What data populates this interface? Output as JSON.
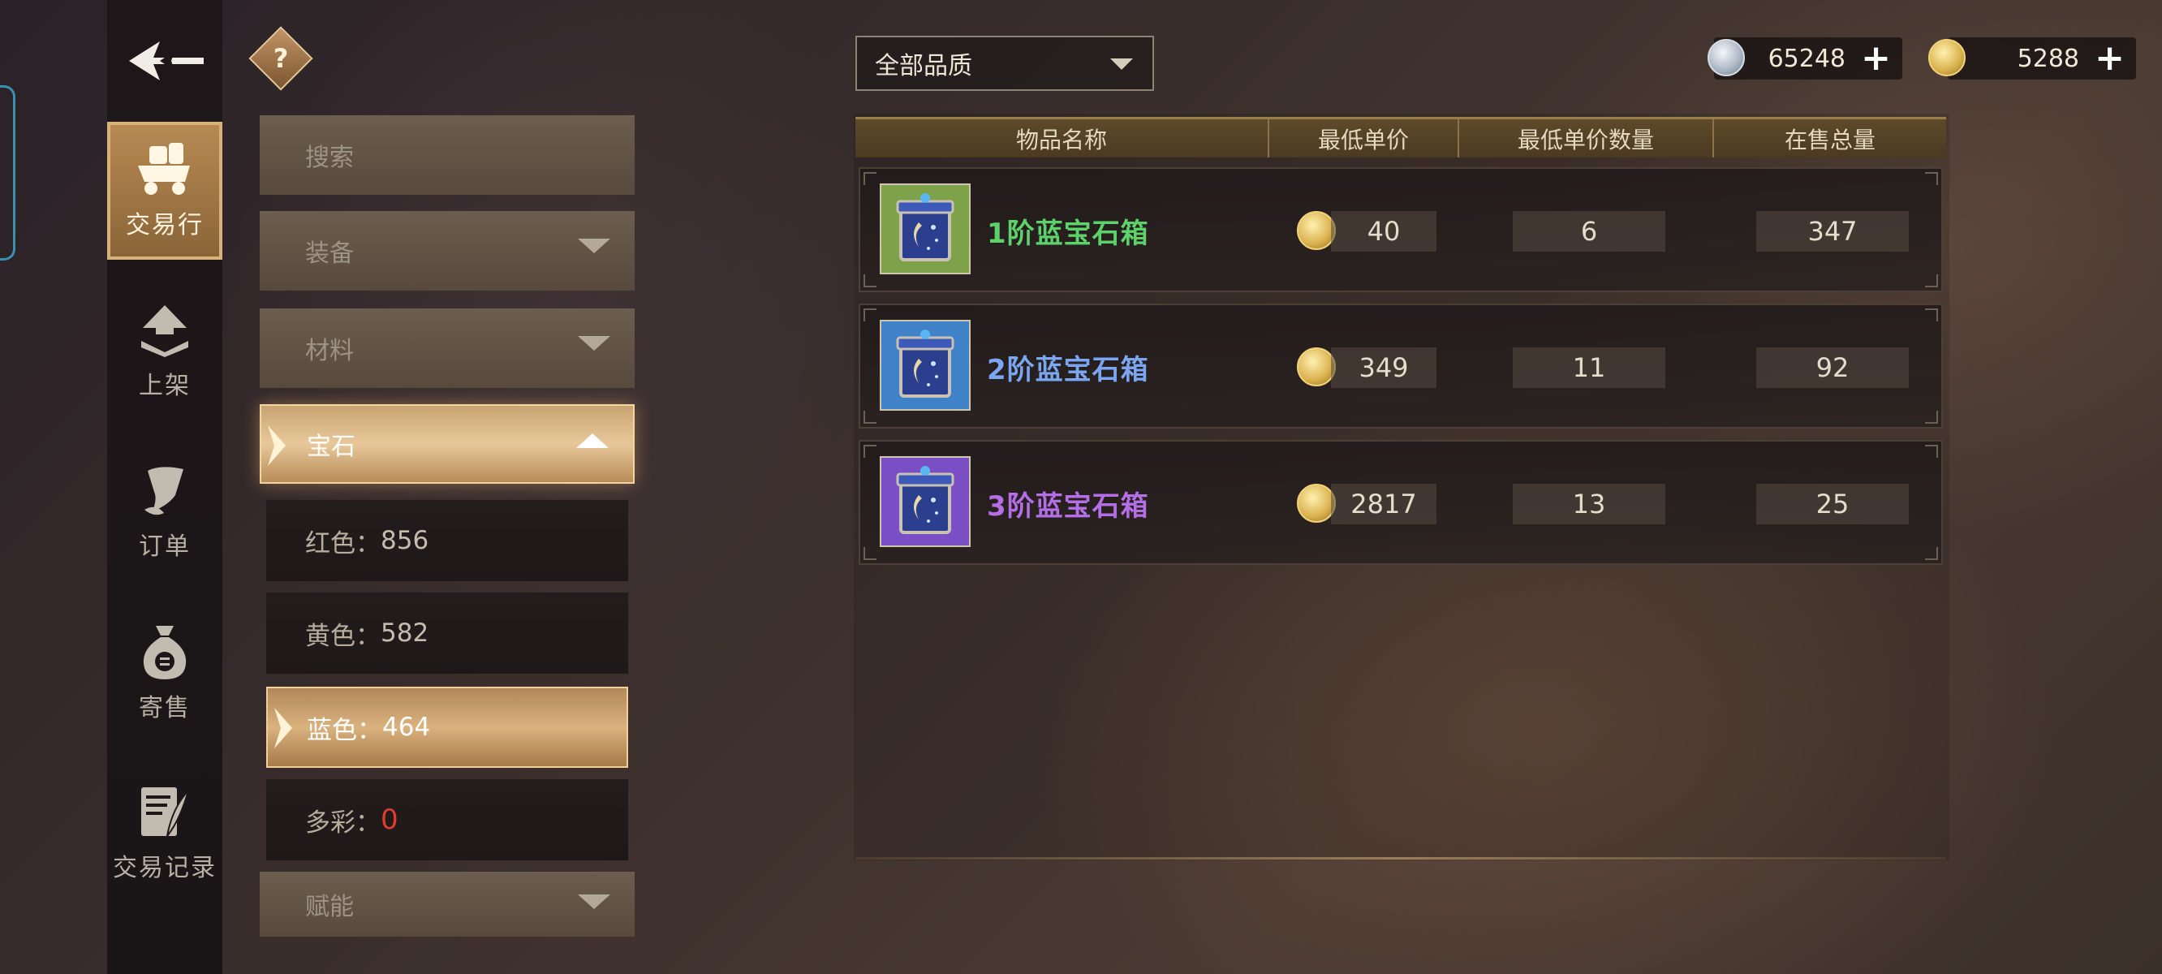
{
  "nav": {
    "items": [
      {
        "label": "交易行",
        "icon": "handcart-icon",
        "active": true
      },
      {
        "label": "上架",
        "icon": "upload-arrow-icon",
        "active": false
      },
      {
        "label": "订单",
        "icon": "scroll-icon",
        "active": false
      },
      {
        "label": "寄售",
        "icon": "money-bag-icon",
        "active": false
      },
      {
        "label": "交易记录",
        "icon": "quill-record-icon",
        "active": false
      }
    ]
  },
  "help_label": "?",
  "categories": {
    "search": "搜索",
    "equipment": "装备",
    "material": "材料",
    "gem": "宝石",
    "gem_subs": [
      {
        "label": "红色：",
        "count": "856"
      },
      {
        "label": "黄色：",
        "count": "582"
      },
      {
        "label": "蓝色：",
        "count": "464"
      },
      {
        "label": "多彩：",
        "count": "0"
      }
    ],
    "talent": "赋能"
  },
  "quality_filter": {
    "selected": "全部品质"
  },
  "currency": {
    "silver": "65248",
    "gold": "5288",
    "add": "+"
  },
  "table": {
    "headers": [
      "物品名称",
      "最低单价",
      "最低单价数量",
      "在售总量"
    ],
    "rows": [
      {
        "name": "1阶蓝宝石箱",
        "price": "40",
        "price_qty": "6",
        "total": "347",
        "name_color": "#5ed26a",
        "bg": "#7da24a"
      },
      {
        "name": "2阶蓝宝石箱",
        "price": "349",
        "price_qty": "11",
        "total": "92",
        "name_color": "#7aa6f2",
        "bg": "#3f82c8"
      },
      {
        "name": "3阶蓝宝石箱",
        "price": "2817",
        "price_qty": "13",
        "total": "25",
        "name_color": "#b46ee6",
        "bg": "#7a4fc6"
      }
    ]
  }
}
